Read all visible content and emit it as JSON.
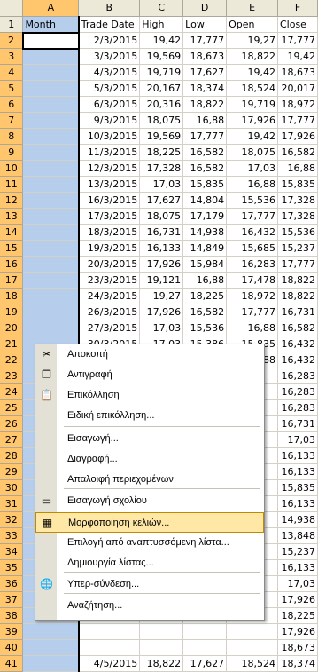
{
  "columns": [
    "A",
    "B",
    "C",
    "D",
    "E",
    "F"
  ],
  "header_row": [
    "Month",
    "Trade Date",
    "High",
    "Low",
    "Open",
    "Close"
  ],
  "rows": [
    {
      "n": "2",
      "date": "2/3/2015",
      "high": "19,42",
      "low": "17,777",
      "open": "19,27",
      "close": "17,777"
    },
    {
      "n": "3",
      "date": "3/3/2015",
      "high": "19,569",
      "low": "18,673",
      "open": "18,822",
      "close": "19,42"
    },
    {
      "n": "4",
      "date": "4/3/2015",
      "high": "19,719",
      "low": "17,627",
      "open": "19,42",
      "close": "18,673"
    },
    {
      "n": "5",
      "date": "5/3/2015",
      "high": "20,167",
      "low": "18,374",
      "open": "18,524",
      "close": "20,017"
    },
    {
      "n": "6",
      "date": "6/3/2015",
      "high": "20,316",
      "low": "18,822",
      "open": "19,719",
      "close": "18,972"
    },
    {
      "n": "7",
      "date": "9/3/2015",
      "high": "18,075",
      "low": "16,88",
      "open": "17,926",
      "close": "17,777"
    },
    {
      "n": "8",
      "date": "10/3/2015",
      "high": "19,569",
      "low": "17,777",
      "open": "19,42",
      "close": "17,926"
    },
    {
      "n": "9",
      "date": "11/3/2015",
      "high": "18,225",
      "low": "16,582",
      "open": "18,075",
      "close": "16,582"
    },
    {
      "n": "10",
      "date": "12/3/2015",
      "high": "17,328",
      "low": "16,582",
      "open": "17,03",
      "close": "16,88"
    },
    {
      "n": "11",
      "date": "13/3/2015",
      "high": "17,03",
      "low": "15,835",
      "open": "16,88",
      "close": "15,835"
    },
    {
      "n": "12",
      "date": "16/3/2015",
      "high": "17,627",
      "low": "14,804",
      "open": "15,536",
      "close": "17,328"
    },
    {
      "n": "13",
      "date": "17/3/2015",
      "high": "18,075",
      "low": "17,179",
      "open": "17,777",
      "close": "17,328"
    },
    {
      "n": "14",
      "date": "18/3/2015",
      "high": "16,731",
      "low": "14,938",
      "open": "16,432",
      "close": "15,536"
    },
    {
      "n": "15",
      "date": "19/3/2015",
      "high": "16,133",
      "low": "14,849",
      "open": "15,685",
      "close": "15,237"
    },
    {
      "n": "16",
      "date": "20/3/2015",
      "high": "17,926",
      "low": "15,984",
      "open": "16,283",
      "close": "17,777"
    },
    {
      "n": "17",
      "date": "23/3/2015",
      "high": "19,121",
      "low": "16,88",
      "open": "17,478",
      "close": "18,822"
    },
    {
      "n": "18",
      "date": "24/3/2015",
      "high": "19,27",
      "low": "18,225",
      "open": "18,972",
      "close": "18,822"
    },
    {
      "n": "19",
      "date": "26/3/2015",
      "high": "17,926",
      "low": "16,582",
      "open": "17,777",
      "close": "16,731"
    },
    {
      "n": "20",
      "date": "27/3/2015",
      "high": "17,03",
      "low": "15,536",
      "open": "16,88",
      "close": "16,582"
    },
    {
      "n": "21",
      "date": "30/3/2015",
      "high": "17,03",
      "low": "15,386",
      "open": "15,835",
      "close": "16,432"
    },
    {
      "n": "22",
      "date": "31/3/2015",
      "high": "17,627",
      "low": "16,432",
      "open": "16,88",
      "close": "16,432"
    },
    {
      "n": "23",
      "date": "",
      "high": "",
      "low": "",
      "open": "",
      "close": "16,283"
    },
    {
      "n": "24",
      "date": "",
      "high": "",
      "low": "",
      "open": "",
      "close": "16,283"
    },
    {
      "n": "25",
      "date": "",
      "high": "",
      "low": "",
      "open": "",
      "close": "16,283"
    },
    {
      "n": "26",
      "date": "",
      "high": "",
      "low": "",
      "open": "",
      "close": "16,731"
    },
    {
      "n": "27",
      "date": "",
      "high": "",
      "low": "",
      "open": "",
      "close": "17,03"
    },
    {
      "n": "28",
      "date": "",
      "high": "",
      "low": "",
      "open": "",
      "close": "16,133"
    },
    {
      "n": "29",
      "date": "",
      "high": "",
      "low": "",
      "open": "",
      "close": "16,133"
    },
    {
      "n": "30",
      "date": "",
      "high": "",
      "low": "",
      "open": "",
      "close": "15,835"
    },
    {
      "n": "31",
      "date": "",
      "high": "",
      "low": "",
      "open": "",
      "close": "16,133"
    },
    {
      "n": "32",
      "date": "",
      "high": "",
      "low": "",
      "open": "",
      "close": "14,938"
    },
    {
      "n": "33",
      "date": "",
      "high": "",
      "low": "",
      "open": "",
      "close": "13,848"
    },
    {
      "n": "34",
      "date": "",
      "high": "",
      "low": "",
      "open": "",
      "close": "15,237"
    },
    {
      "n": "35",
      "date": "",
      "high": "",
      "low": "",
      "open": "",
      "close": "16,133"
    },
    {
      "n": "36",
      "date": "",
      "high": "",
      "low": "",
      "open": "",
      "close": "17,03"
    },
    {
      "n": "37",
      "date": "",
      "high": "",
      "low": "",
      "open": "",
      "close": "17,926"
    },
    {
      "n": "38",
      "date": "",
      "high": "",
      "low": "",
      "open": "",
      "close": "18,225"
    },
    {
      "n": "39",
      "date": "",
      "high": "",
      "low": "",
      "open": "",
      "close": "17,926"
    },
    {
      "n": "40",
      "date": "",
      "high": "",
      "low": "",
      "open": "",
      "close": "18,673"
    },
    {
      "n": "41",
      "date": "4/5/2015",
      "high": "18,822",
      "low": "17,627",
      "open": "18,524",
      "close": "18,374"
    }
  ],
  "context_menu": {
    "items": [
      {
        "label": "Αποκοπή",
        "icon": "scissors-icon",
        "glyph": "✂"
      },
      {
        "label": "Αντιγραφή",
        "icon": "copy-icon",
        "glyph": "❐"
      },
      {
        "label": "Επικόλληση",
        "icon": "paste-icon",
        "glyph": "📋"
      },
      {
        "label": "Ειδική επικόλληση...",
        "icon": "",
        "glyph": ""
      },
      {
        "label": "Εισαγωγή...",
        "icon": "",
        "glyph": ""
      },
      {
        "label": "Διαγραφή...",
        "icon": "",
        "glyph": ""
      },
      {
        "label": "Απαλοιφή περιεχομένων",
        "icon": "",
        "glyph": ""
      },
      {
        "label": "Εισαγωγή σχολίου",
        "icon": "comment-icon",
        "glyph": "▭"
      },
      {
        "label": "Μορφοποίηση κελιών...",
        "icon": "format-cells-icon",
        "glyph": "▦"
      },
      {
        "label": "Επιλογή από αναπτυσσόμενη λίστα...",
        "icon": "",
        "glyph": ""
      },
      {
        "label": "Δημιουργία λίστας...",
        "icon": "",
        "glyph": ""
      },
      {
        "label": "Υπερ-σύνδεση...",
        "icon": "hyperlink-icon",
        "glyph": "🌐"
      },
      {
        "label": "Αναζήτηση...",
        "icon": "",
        "glyph": ""
      }
    ],
    "highlighted_index": 8
  },
  "colors": {
    "selection": "#b6cdec",
    "header_selected": "#ffc66e",
    "highlight": "#ffe8a6"
  }
}
